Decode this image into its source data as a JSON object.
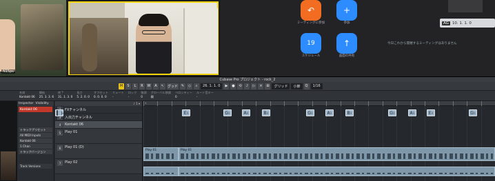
{
  "video": {
    "participant1_tag": "N15ps",
    "zoom": {
      "items": [
        {
          "label": "ミーティングに参加",
          "icon": "join-icon",
          "color": "#f26d21"
        },
        {
          "label": "参加",
          "icon": "plus-icon",
          "color": "#2d8cff"
        },
        {
          "label": "スケジュール",
          "icon": "calendar-icon",
          "color": "#2d8cff",
          "day": "19"
        },
        {
          "label": "画面の共有",
          "icon": "share-screen-icon",
          "color": "#2d8cff"
        }
      ],
      "message": "今日これから開催するミーティングはありません",
      "mini_time": {
        "tag": "AG",
        "value": "10. 1. 1. 0"
      }
    }
  },
  "cubase": {
    "title": "Cubase Pro プロジェクト - rock_2",
    "toolbar": {
      "buttons": [
        "M",
        "S",
        "L",
        "R",
        "W",
        "A"
      ],
      "snap_label": "グッド",
      "position": "26. 1. 1. 0",
      "grid": "グリッド",
      "measure": "小節",
      "quant": "1/16"
    },
    "infoline": [
      {
        "h": "名前",
        "v": "Kontakt 06"
      },
      {
        "h": "開始",
        "v": "25. 3. 3. 6"
      },
      {
        "h": "終了",
        "v": "31. 1. 3. 0"
      },
      {
        "h": "長さ",
        "v": "5. 2. 0. 0"
      },
      {
        "h": "オフセット",
        "v": "0. 0. 0. 0"
      },
      {
        "h": "ミュート",
        "v": "-"
      },
      {
        "h": "ロック",
        "v": "-"
      },
      {
        "h": "移調",
        "v": "0"
      },
      {
        "h": "グローバル移調",
        "v": "親"
      },
      {
        "h": "ベロシティー",
        "v": "0"
      },
      {
        "h": "ルート音キー",
        "v": "-"
      }
    ],
    "inspector": {
      "tabs": [
        "Inspector",
        "Visibility"
      ],
      "track_name": "Kontakt 06",
      "rows": [
        "トラックプリセット",
        "All MIDI Inputs",
        "Kontakt 06",
        "1 Chan",
        "トラックバージョン"
      ],
      "footer": "Track Versions"
    },
    "tracklist": {
      "header": "♪ 1 ▾",
      "tracks": [
        {
          "num": "1",
          "name": "コードトラック",
          "kind": "chord"
        },
        {
          "num": "2",
          "name": "FXチャンネル",
          "kind": "folder"
        },
        {
          "num": "3",
          "name": "入出力チャンネル",
          "kind": "folder"
        },
        {
          "num": "4",
          "name": "Kontakt 06",
          "kind": "sel"
        },
        {
          "num": "5",
          "name": "Play 01",
          "kind": "instr"
        },
        {
          "num": "6",
          "name": "Play 01 (D)",
          "kind": "instr"
        },
        {
          "num": "7",
          "name": "Play 02",
          "kind": "instr"
        }
      ]
    },
    "ruler": [
      "1",
      "",
      "",
      "",
      "",
      "",
      "",
      "",
      "",
      "",
      "",
      "",
      "",
      "",
      "",
      "",
      "",
      "",
      "",
      "",
      "",
      "",
      "",
      "",
      ""
    ],
    "chords": [
      {
        "label": "E♭",
        "pos": 0.11
      },
      {
        "label": "G♭",
        "pos": 0.228
      },
      {
        "label": "A♭",
        "pos": 0.28
      },
      {
        "label": "B♭",
        "pos": 0.338
      },
      {
        "label": "G♭",
        "pos": 0.462
      },
      {
        "label": "A♭",
        "pos": 0.518
      },
      {
        "label": "B♭",
        "pos": 0.574
      },
      {
        "label": "G♭",
        "pos": 0.696
      },
      {
        "label": "A♭",
        "pos": 0.752
      },
      {
        "label": "E♭",
        "pos": 0.806
      },
      {
        "label": "G♭",
        "pos": 0.926
      }
    ],
    "clips": [
      {
        "label": "Play 01",
        "start": 0.0,
        "end": 0.1
      },
      {
        "label": "Play 01",
        "start": 0.1,
        "end": 1.0
      }
    ],
    "clip_row2": [
      {
        "label": "",
        "start": 0.0,
        "end": 0.1
      },
      {
        "label": "",
        "start": 0.1,
        "end": 1.0
      }
    ]
  }
}
